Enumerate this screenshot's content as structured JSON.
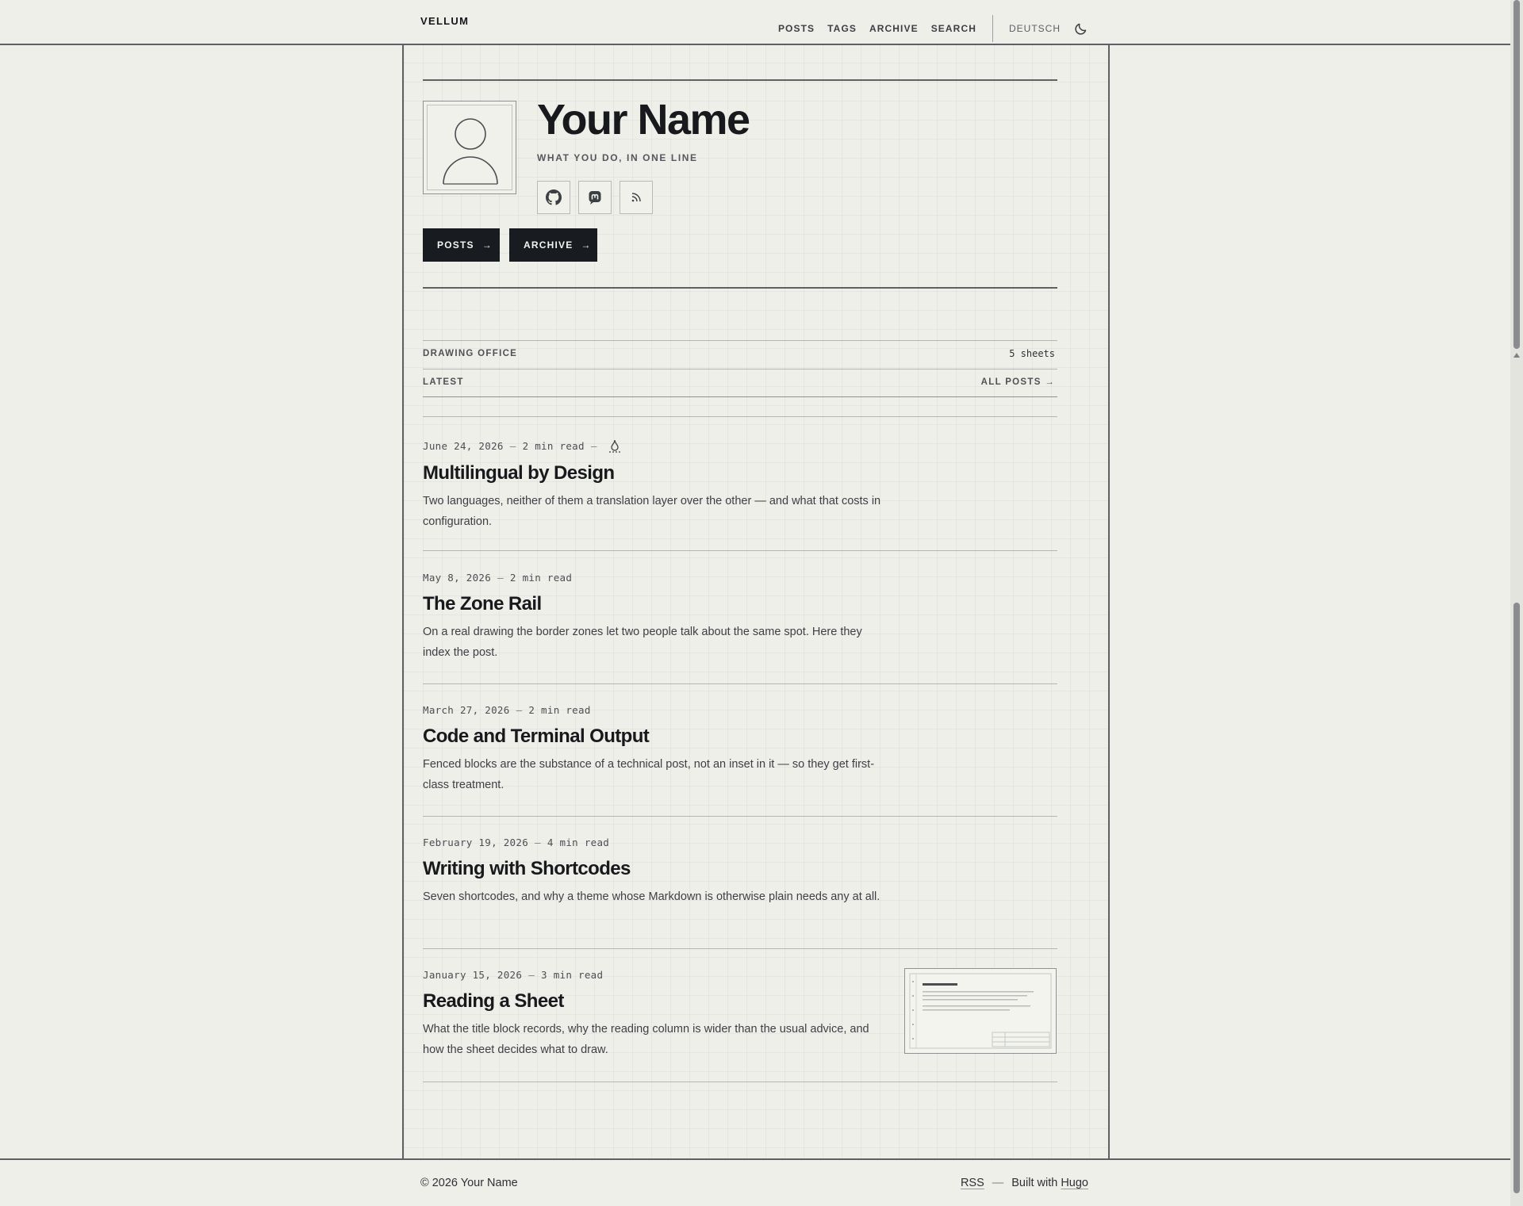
{
  "header": {
    "brand": "VELLUM",
    "nav": [
      "POSTS",
      "TAGS",
      "ARCHIVE",
      "SEARCH"
    ],
    "language": "DEUTSCH",
    "theme_icon": "moon-icon"
  },
  "profile": {
    "name": "Your Name",
    "tagline": "WHAT YOU DO, IN ONE LINE",
    "social_icons": [
      "github-icon",
      "mastodon-icon",
      "rss-icon"
    ],
    "buttons": {
      "posts": "POSTS",
      "archive": "ARCHIVE",
      "arrow": "→"
    }
  },
  "drawing_office": {
    "label": "DRAWING OFFICE",
    "count": "5 sheets"
  },
  "latest": {
    "label": "LATEST",
    "all_posts": "ALL POSTS →"
  },
  "posts": [
    {
      "date": "June 24, 2026",
      "read": "2 min read",
      "title": "Multilingual by Design",
      "summary": "Two languages, neither of them a translation layer over the other — and what that costs in configuration."
    },
    {
      "date": "May 8, 2026",
      "read": "2 min read",
      "title": "The Zone Rail",
      "summary": "On a real drawing the border zones let two people talk about the same spot. Here they index the post."
    },
    {
      "date": "March 27, 2026",
      "read": "2 min read",
      "title": "Code and Terminal Output",
      "summary": "Fenced blocks are the substance of a technical post, not an inset in it — so they get first-class treatment."
    },
    {
      "date": "February 19, 2026",
      "read": "4 min read",
      "title": "Writing with Shortcodes",
      "summary": "Seven shortcodes, and why a theme whose Markdown is otherwise plain needs any at all."
    },
    {
      "date": "January 15, 2026",
      "read": "3 min read",
      "title": "Reading a Sheet",
      "summary": "What the title block records, why the reading column is wider than the usual advice, and how the sheet decides what to draw."
    }
  ],
  "footer": {
    "copyright": "© 2026 Your Name",
    "rss": "RSS",
    "dash": "—",
    "built_with": "Built with",
    "hugo": "Hugo"
  }
}
